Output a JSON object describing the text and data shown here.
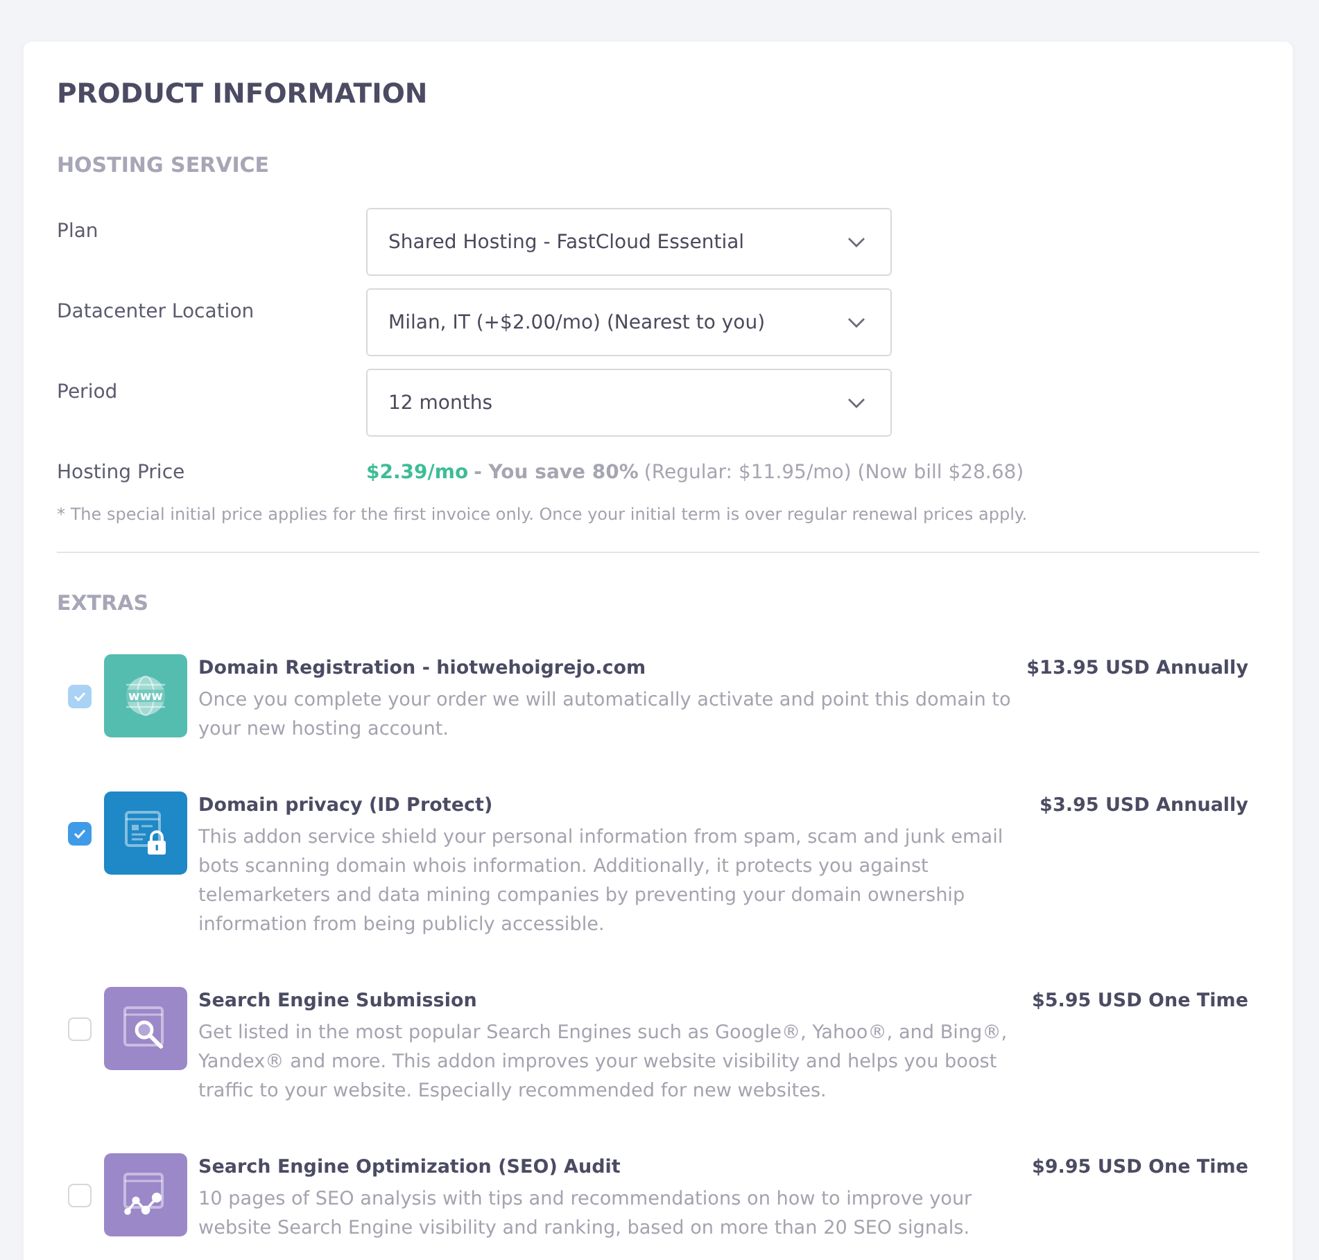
{
  "title": "PRODUCT INFORMATION",
  "hosting_service": {
    "heading": "HOSTING SERVICE",
    "fields": [
      {
        "label": "Plan",
        "value": "Shared Hosting - FastCloud Essential"
      },
      {
        "label": "Datacenter Location",
        "value": "Milan, IT (+$2.00/mo) (Nearest to you)"
      },
      {
        "label": "Period",
        "value": "12 months"
      }
    ],
    "hosting_price": {
      "label": "Hosting Price",
      "price": "$2.39/mo",
      "savings": "- You save 80%",
      "details": "(Regular: $11.95/mo) (Now bill $28.68)"
    },
    "note": "* The special initial price applies for the first invoice only. Once your initial term is over regular renewal prices apply."
  },
  "extras": {
    "heading": "EXTRAS",
    "items": [
      {
        "title": "Domain Registration - hiotwehoigrejo.com",
        "description": "Once you complete your order we will automatically activate and point this domain to your new hosting account.",
        "price": "$13.95 USD Annually",
        "checked": true,
        "disabled": true,
        "color": "#55bcb0",
        "icon_label": "www"
      },
      {
        "title": "Domain privacy (ID Protect)",
        "description": "This addon service shield your personal information from spam, scam and junk email bots scanning domain whois information. Additionally, it protects you against telemarketers and data mining companies by preventing your domain ownership information from being publicly accessible.",
        "price": "$3.95 USD Annually",
        "checked": true,
        "disabled": false,
        "color": "#1f88c6"
      },
      {
        "title": "Search Engine Submission",
        "description": "Get listed in the most popular Search Engines such as Google®, Yahoo®, and Bing®, Yandex® and more. This addon improves your website visibility and helps you boost traffic to your website. Especially recommended for new websites.",
        "price": "$5.95 USD One Time",
        "checked": false,
        "disabled": false,
        "color": "#9b88c8"
      },
      {
        "title": "Search Engine Optimization (SEO) Audit",
        "description": "10 pages of SEO analysis with tips and recommendations on how to improve your website Search Engine visibility and ranking, based on more than 20 SEO signals.",
        "price": "$9.95 USD One Time",
        "checked": false,
        "disabled": false,
        "color": "#9b88c8"
      }
    ]
  }
}
